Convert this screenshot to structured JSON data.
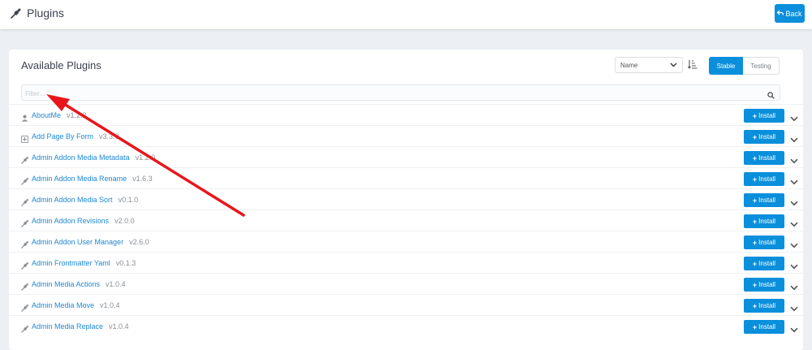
{
  "header": {
    "title": "Plugins",
    "back_label": "Back"
  },
  "card": {
    "title": "Available Plugins",
    "sort_value": "Name",
    "tabs": [
      {
        "label": "Stable",
        "active": true
      },
      {
        "label": "Testing",
        "active": false
      }
    ],
    "filter_placeholder": "Filter..."
  },
  "install_label": "Install",
  "plugins": [
    {
      "name": "AboutMe",
      "version": "v1.2.2",
      "icon": "user-icon"
    },
    {
      "name": "Add Page By Form",
      "version": "v3.3.0",
      "icon": "plus-square-icon"
    },
    {
      "name": "Admin Addon Media Metadata",
      "version": "v1.2.0",
      "icon": "plug-icon"
    },
    {
      "name": "Admin Addon Media Rename",
      "version": "v1.6.3",
      "icon": "plug-icon"
    },
    {
      "name": "Admin Addon Media Sort",
      "version": "v0.1.0",
      "icon": "plug-icon"
    },
    {
      "name": "Admin Addon Revisions",
      "version": "v2.0.0",
      "icon": "plug-icon"
    },
    {
      "name": "Admin Addon User Manager",
      "version": "v2.6.0",
      "icon": "plug-icon"
    },
    {
      "name": "Admin Frontmatter Yaml",
      "version": "v0.1.3",
      "icon": "plug-icon"
    },
    {
      "name": "Admin Media Actions",
      "version": "v1.0.4",
      "icon": "plug-icon"
    },
    {
      "name": "Admin Media Move",
      "version": "v1.0.4",
      "icon": "plug-icon"
    },
    {
      "name": "Admin Media Replace",
      "version": "v1.0.4",
      "icon": "plug-icon"
    }
  ],
  "colors": {
    "accent": "#0a8fdc",
    "link": "#1e88d4",
    "annotation_arrow": "#e8161b"
  }
}
